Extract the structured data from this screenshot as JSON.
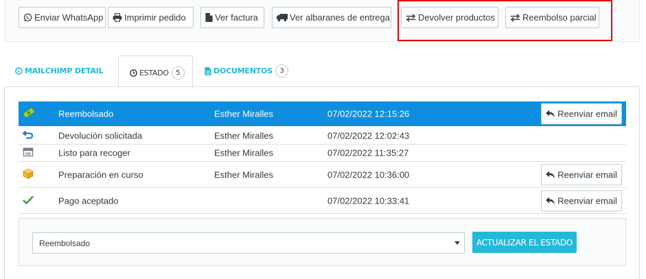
{
  "toolbar": {
    "buttons": [
      {
        "label": "Enviar WhatsApp",
        "icon": "whatsapp-icon"
      },
      {
        "label": "Imprimir pedido",
        "icon": "print-icon"
      },
      {
        "label": "Ver factura",
        "icon": "file-icon"
      },
      {
        "label": "Ver albaranes de entrega",
        "icon": "truck-icon"
      },
      {
        "label": "Devolver productos",
        "icon": "exchange-icon"
      },
      {
        "label": "Reembolso parcial",
        "icon": "exchange-icon"
      }
    ],
    "highlight_color": "#e3000f"
  },
  "tabs": [
    {
      "label": "Mailchimp Detail",
      "icon": "info-circle-icon"
    },
    {
      "label": "Estado",
      "icon": "clock-icon",
      "count": "5",
      "active": true
    },
    {
      "label": "Documentos",
      "icon": "document-icon",
      "count": "3"
    }
  ],
  "history": {
    "resend_label": "Reenviar email",
    "rows": [
      {
        "status": "Reembolsado",
        "user": "Esther Miralles",
        "date": "07/02/2022 12:15:26",
        "icon": "money-icon",
        "resend": true,
        "active": true
      },
      {
        "status": "Devolución solicitada",
        "user": "Esther Miralles",
        "date": "07/02/2022 12:02:43",
        "icon": "return-arrow-icon",
        "resend": false
      },
      {
        "status": "Listo para recoger",
        "user": "Esther Miralles",
        "date": "07/02/2022 11:35:27",
        "icon": "store-icon",
        "resend": false
      },
      {
        "status": "Preparación en curso",
        "user": "Esther Miralles",
        "date": "07/02/2022 10:36:00",
        "icon": "box-icon",
        "resend": true
      },
      {
        "status": "Pago aceptado",
        "user": "",
        "date": "07/02/2022 10:33:41",
        "icon": "check-icon",
        "resend": true
      }
    ]
  },
  "status_form": {
    "selected": "Reembolsado",
    "submit_label": "Actualizar el estado"
  },
  "colors": {
    "accent": "#25b9d7",
    "active_row": "#0f8ee0"
  }
}
